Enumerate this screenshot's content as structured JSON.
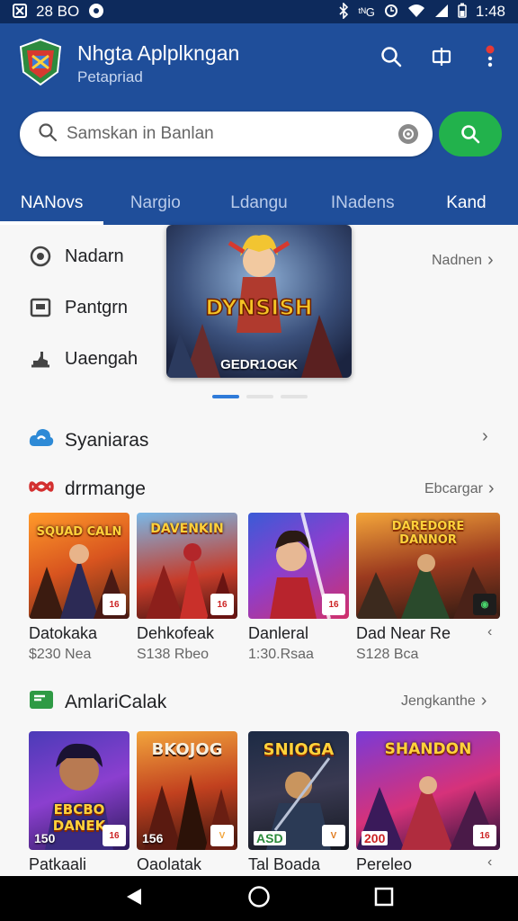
{
  "status_bar": {
    "time_left": "28 BO",
    "signal_text": "ᵗᴺG",
    "clock": "1:48"
  },
  "header": {
    "title": "Nhgta Aplplkngan",
    "subtitle": "Petapriad",
    "search_placeholder": "Samskan in Banlan"
  },
  "tabs": [
    {
      "label": "NANovs",
      "active": true
    },
    {
      "label": "Nargio",
      "active": false
    },
    {
      "label": "Ldangu",
      "active": false
    },
    {
      "label": "INadens",
      "active": false
    },
    {
      "label": "Kand",
      "active": false
    }
  ],
  "menu": [
    {
      "label": "Nadarn",
      "icon": "disc-icon"
    },
    {
      "label": "Pantgrn",
      "icon": "box-icon"
    },
    {
      "label": "Uaengah",
      "icon": "download-icon"
    }
  ],
  "banner": {
    "logo_text": "DYNSISH",
    "caption": "GEDR1OGK",
    "side_link": "Nadnen"
  },
  "sections": {
    "syaniaras": {
      "title": "Syaniaras"
    },
    "drrmange": {
      "title": "drrmange",
      "link": "Ebcargar",
      "cards": [
        {
          "title": "Datokaka",
          "price": "$230 Nea",
          "art": "SQUAD CALN"
        },
        {
          "title": "Dehkofeak",
          "price": "S138 Rbeo",
          "art": "DAVENKIN"
        },
        {
          "title": "Danleral",
          "price": "1:30.Rsaa",
          "art": ""
        },
        {
          "title": "Dad Near Re",
          "price": "S128 Bca",
          "art": "DAREDORE DANNOR"
        }
      ]
    },
    "amlari": {
      "title": "AmlariCalak",
      "link": "Jengkanthe",
      "cards": [
        {
          "title": "Patkaali",
          "num": "150",
          "art": "EBCBO DANEK"
        },
        {
          "title": "Oaolatak",
          "num": "156",
          "art": "BKOJOG"
        },
        {
          "title": "Tal Boada",
          "num": "ASD",
          "art": "SNIOGA"
        },
        {
          "title": "Pereleo",
          "num": "200",
          "art": "SHANDON"
        }
      ]
    }
  },
  "colors": {
    "header_blue": "#1f4e9a",
    "status_dark": "#0d2a5c",
    "search_green": "#22b24c",
    "indicator_blue": "#2f7bd9"
  }
}
